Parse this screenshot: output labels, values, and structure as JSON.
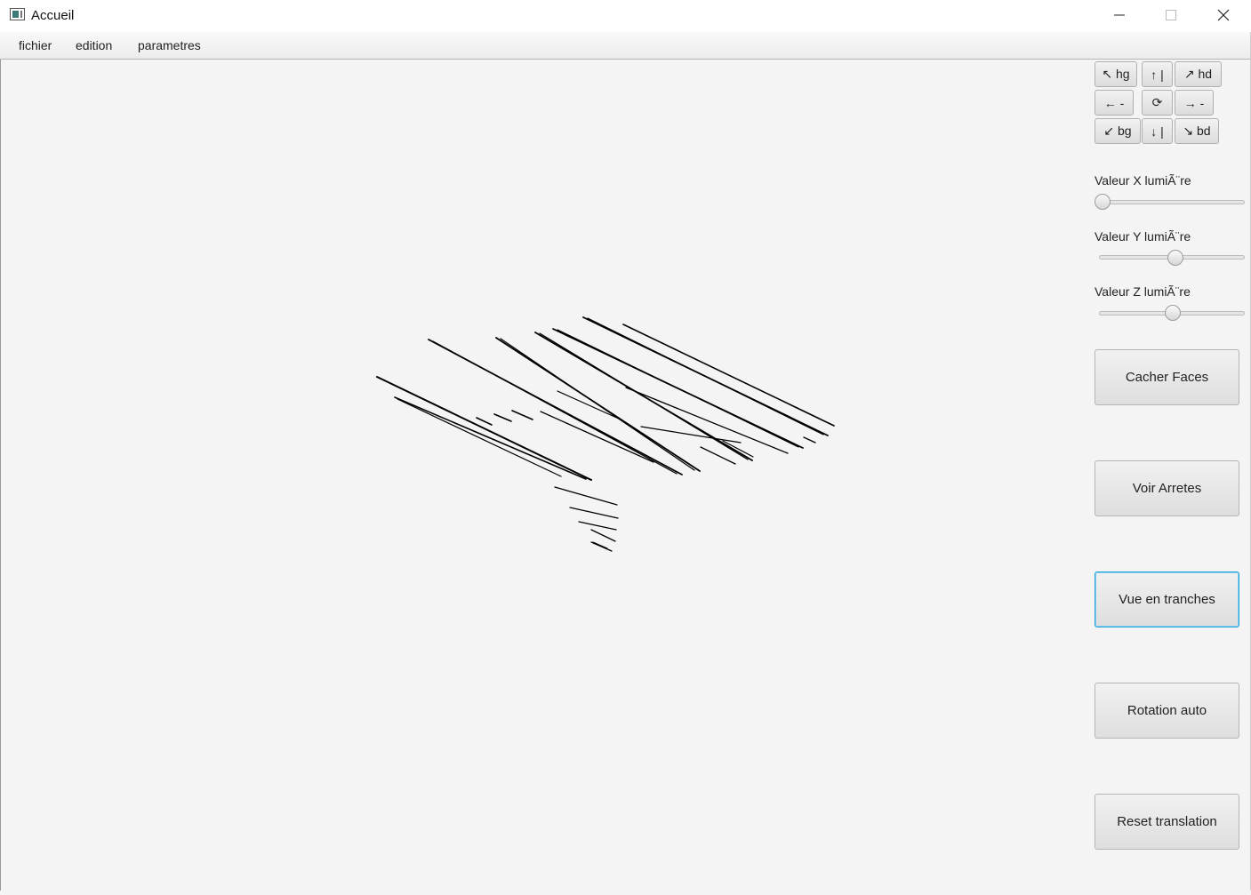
{
  "window": {
    "title": "Accueil",
    "controls": {
      "minimize": "minimize-icon",
      "maximize": "maximize-icon",
      "close": "close-icon"
    }
  },
  "menu": {
    "items": [
      "fichier",
      "edition",
      "parametres"
    ]
  },
  "nav": {
    "hg": "↖ hg",
    "up": "↑ |",
    "hd": "↗ hd",
    "left": "← -",
    "center": "⟳",
    "right": "→ -",
    "bg": "↙ bg",
    "down": "↓ |",
    "bd": "↘ bd"
  },
  "sliders": [
    {
      "label": "Valeur X lumiÃ¨re",
      "value_fraction": 0.0
    },
    {
      "label": "Valeur Y lumiÃ¨re",
      "value_fraction": 0.52
    },
    {
      "label": "Valeur Z lumiÃ¨re",
      "value_fraction": 0.5
    }
  ],
  "buttons": {
    "hide_faces": "Cacher Faces",
    "show_edges": "Voir Arretes",
    "slice_view": "Vue en tranches",
    "auto_rotation": "Rotation auto",
    "reset_translation": "Reset translation"
  },
  "colors": {
    "focus_border": "#1ea0dc",
    "background": "#f4f4f4",
    "model_lines": "#000000"
  }
}
